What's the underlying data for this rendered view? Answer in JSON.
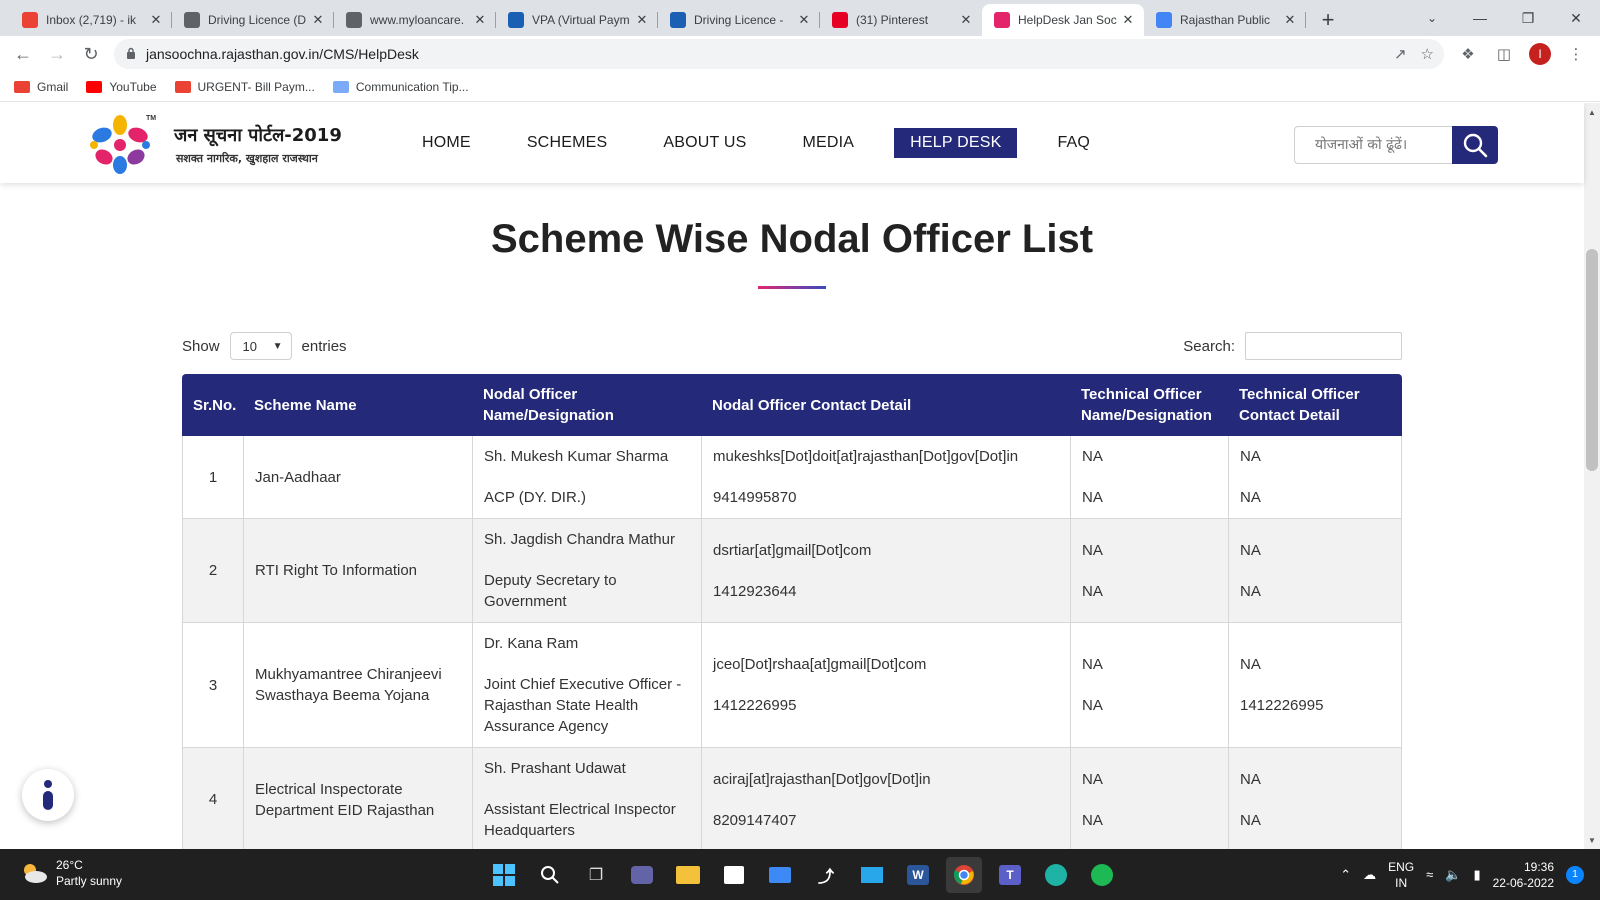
{
  "browser": {
    "tabs": [
      {
        "title": "Inbox (2,719) - ik",
        "icon": "gmail-icon",
        "color": "#ea4335"
      },
      {
        "title": "Driving Licence (D",
        "icon": "globe-icon",
        "color": "#5f6368"
      },
      {
        "title": "www.myloancare.",
        "icon": "globe-icon",
        "color": "#5f6368"
      },
      {
        "title": "VPA (Virtual Paym",
        "icon": "site-icon",
        "color": "#1a5fb4"
      },
      {
        "title": "Driving Licence - ",
        "icon": "site-icon",
        "color": "#1a5fb4"
      },
      {
        "title": "(31) Pinterest",
        "icon": "pinterest-icon",
        "color": "#e60023"
      },
      {
        "title": "HelpDesk Jan Soc",
        "icon": "jansoochna-icon",
        "color": "#e3246b"
      },
      {
        "title": "Rajasthan Public ",
        "icon": "docs-icon",
        "color": "#4285f4"
      }
    ],
    "active_tab": 6,
    "url": "jansoochna.rajasthan.gov.in/CMS/HelpDesk",
    "profile_initial": "I",
    "bookmarks": [
      {
        "label": "Gmail",
        "icon": "gmail-icon"
      },
      {
        "label": "YouTube",
        "icon": "youtube-icon"
      },
      {
        "label": "URGENT- Bill Paym...",
        "icon": "gmail-icon"
      },
      {
        "label": "Communication Tip...",
        "icon": "image-icon"
      }
    ]
  },
  "site": {
    "logo_title": "जन सूचना पोर्टल-2019",
    "logo_subtitle": "सशक्त नागरिक, खुशहाल राजस्थान",
    "logo_tm": "TM",
    "nav": [
      "HOME",
      "SCHEMES",
      "ABOUT US",
      "MEDIA",
      "HELP DESK",
      "FAQ"
    ],
    "nav_active": 4,
    "search_placeholder": "योजनाओं को ढूंढें।",
    "accent": "#25297a"
  },
  "page": {
    "title": "Scheme Wise Nodal Officer List",
    "show_label": "Show",
    "entries_value": "10",
    "entries_label": "entries",
    "search_label": "Search:"
  },
  "table": {
    "headers": [
      "Sr.No.",
      "Scheme Name",
      "Nodal Officer Name/Designation",
      "Nodal Officer Contact Detail",
      "Technical Officer Name/Designation",
      "Technical Officer Contact Detail"
    ],
    "rows": [
      {
        "sr": "1",
        "scheme": "Jan-Aadhaar",
        "officer_name": "Sh. Mukesh Kumar Sharma",
        "officer_designation": "ACP (DY. DIR.)",
        "email": "mukeshks[Dot]doit[at]rajasthan[Dot]gov[Dot]in",
        "phone": "9414995870",
        "tech_name": "NA",
        "tech_designation": "NA",
        "tech_email": "NA",
        "tech_phone": "NA"
      },
      {
        "sr": "2",
        "scheme": "RTI Right To Information",
        "officer_name": "Sh. Jagdish Chandra Mathur",
        "officer_designation": "Deputy Secretary to Government",
        "email": "dsrtiar[at]gmail[Dot]com",
        "phone": "1412923644",
        "tech_name": "NA",
        "tech_designation": "NA",
        "tech_email": "NA",
        "tech_phone": "NA"
      },
      {
        "sr": "3",
        "scheme": "Mukhyamantree Chiranjeevi Swasthaya Beema Yojana",
        "officer_name": "Dr. Kana Ram",
        "officer_designation": "Joint Chief Executive Officer - Rajasthan State Health Assurance Agency",
        "email": "jceo[Dot]rshaa[at]gmail[Dot]com",
        "phone": "1412226995",
        "tech_name": "NA",
        "tech_designation": "NA",
        "tech_email": "NA",
        "tech_phone": "1412226995"
      },
      {
        "sr": "4",
        "scheme": "Electrical Inspectorate Department EID Rajasthan",
        "officer_name": "Sh. Prashant Udawat",
        "officer_designation": "Assistant Electrical Inspector Headquarters",
        "email": "aciraj[at]rajasthan[Dot]gov[Dot]in",
        "phone": "8209147407",
        "tech_name": "NA",
        "tech_designation": "NA",
        "tech_email": "NA",
        "tech_phone": "NA"
      }
    ]
  },
  "taskbar": {
    "temperature": "26°C",
    "weather": "Partly sunny",
    "lang_top": "ENG",
    "lang_bottom": "IN",
    "time": "19:36",
    "date": "22-06-2022",
    "notification_count": "1"
  }
}
